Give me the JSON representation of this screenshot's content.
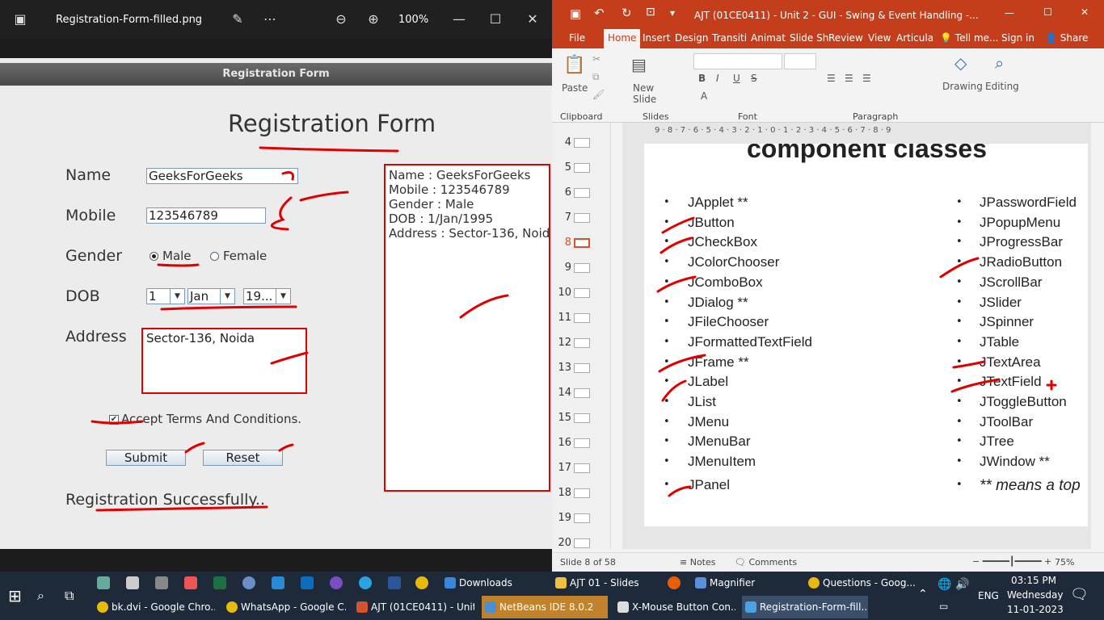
{
  "viewer": {
    "filename": "Registration-Form-filled.png",
    "zoom": "100%",
    "window_title": "Registration Form"
  },
  "form": {
    "heading": "Registration Form",
    "name_label": "Name",
    "name_value": "GeeksForGeeks",
    "mobile_label": "Mobile",
    "mobile_value": "123546789",
    "gender_label": "Gender",
    "gender_male": "Male",
    "gender_female": "Female",
    "dob_label": "DOB",
    "dob_day": "1",
    "dob_month": "Jan",
    "dob_year": "19...",
    "address_label": "Address",
    "address_value": "Sector-136, Noida",
    "terms": "Accept Terms And Conditions.",
    "submit": "Submit",
    "reset": "Reset",
    "result": "Registration Successfully..",
    "output": [
      "Name : GeeksForGeeks",
      "Mobile : 123546789",
      "Gender : Male",
      "DOB : 1/Jan/1995",
      "Address : Sector-136, Noid"
    ]
  },
  "ppt": {
    "title": "AJT (01CE0411) - Unit 2 - GUI - Swing & Event Handling -...",
    "tabs": [
      "File",
      "Home",
      "Insert",
      "Design",
      "Transiti",
      "Animat",
      "Slide Sh",
      "Review",
      "View",
      "Articula"
    ],
    "tell_me": "Tell me...",
    "sign_in": "Sign in",
    "share": "Share",
    "groups": {
      "clipboard": "Clipboard",
      "slides": "Slides",
      "font": "Font",
      "paragraph": "Paragraph"
    },
    "buttons": {
      "paste": "Paste",
      "new_slide": "New Slide",
      "drawing": "Drawing",
      "editing": "Editing"
    },
    "ruler": "9 · 8 · 7 · 6 · 5 · 4 · 3 · 2 · 1 · 0 · 1 · 2 · 3 · 4 · 5 · 6 · 7 · 8 · 9",
    "thumb_numbers": [
      "4",
      "5",
      "6",
      "7",
      "8",
      "9",
      "10",
      "11",
      "12",
      "13",
      "14",
      "15",
      "16",
      "17",
      "18",
      "19",
      "20"
    ],
    "slide_heading": "component classes",
    "left_col": [
      "JApplet **",
      "JButton",
      "JCheckBox",
      "JColorChooser",
      "JComboBox",
      "JDialog **",
      "JFileChooser",
      "JFormattedTextField",
      "JFrame **",
      "JLabel",
      "JList",
      "JMenu",
      "JMenuBar",
      "JMenuItem",
      "JPanel"
    ],
    "right_col": [
      "JPasswordField",
      "JPopupMenu",
      "JProgressBar",
      "JRadioButton",
      "JScrollBar",
      "JSlider",
      "JSpinner",
      "JTable",
      "JTextArea",
      "JTextField",
      "JToggleButton",
      "JToolBar",
      "JTree",
      "JWindow **",
      "** means a top"
    ],
    "status": {
      "slide": "Slide 8 of 58",
      "notes": "Notes",
      "comments": "Comments",
      "zoom": "75%"
    }
  },
  "taskbar": {
    "row1": [
      "Downloads",
      "AJT 01 - Slides",
      "Magnifier",
      "Questions - Goog..."
    ],
    "row2": [
      "bk.dvi - Google Chro...",
      "WhatsApp - Google C...",
      "AJT (01CE0411) - Unit...",
      "NetBeans IDE 8.0.2",
      "X-Mouse Button Con...",
      "Registration-Form-fill..."
    ],
    "lang": "ENG",
    "time": "03:15 PM",
    "day": "Wednesday",
    "date": "11-01-2023"
  }
}
